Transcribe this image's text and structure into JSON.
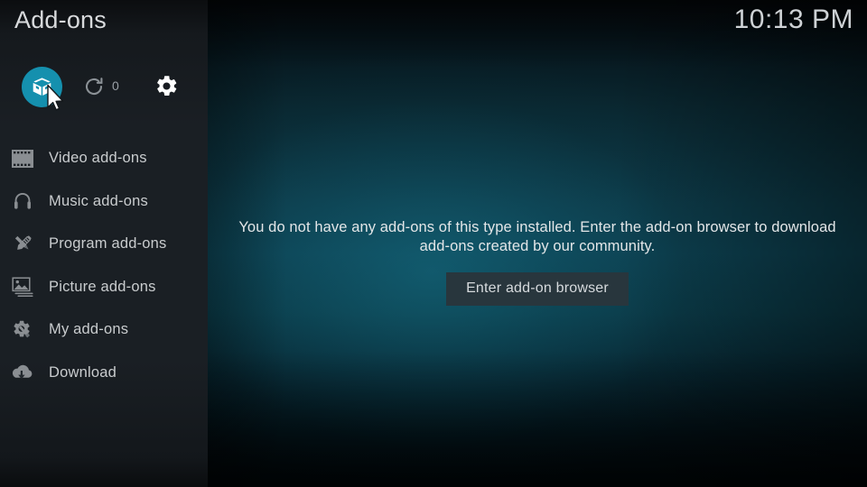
{
  "window": {
    "title": "Add-ons",
    "clock": "10:13 PM"
  },
  "toolbar": {
    "addons_button_icon": "open-box-icon",
    "update_button_icon": "refresh-icon",
    "update_count": "0",
    "settings_button_icon": "gear-icon"
  },
  "sidebar": {
    "items": [
      {
        "label": "Video add-ons",
        "icon": "film-strip-icon"
      },
      {
        "label": "Music add-ons",
        "icon": "headphones-icon"
      },
      {
        "label": "Program add-ons",
        "icon": "pencil-ruler-icon"
      },
      {
        "label": "Picture add-ons",
        "icon": "photos-icon"
      },
      {
        "label": "My add-ons",
        "icon": "gear-screwdriver-icon"
      },
      {
        "label": "Download",
        "icon": "cloud-download-icon"
      }
    ]
  },
  "main": {
    "empty_message_line1": "You do not have any add-ons of this type installed. Enter the add-on browser to download",
    "empty_message_line2": "add-ons created by our community.",
    "browser_button_label": "Enter add-on browser"
  },
  "colors": {
    "accent_teal": "#1590ae",
    "sidebar_bg": "#1a1f24",
    "button_bg": "#28363d",
    "text_primary": "#e3e6e8",
    "text_muted": "#9aa0a6"
  }
}
